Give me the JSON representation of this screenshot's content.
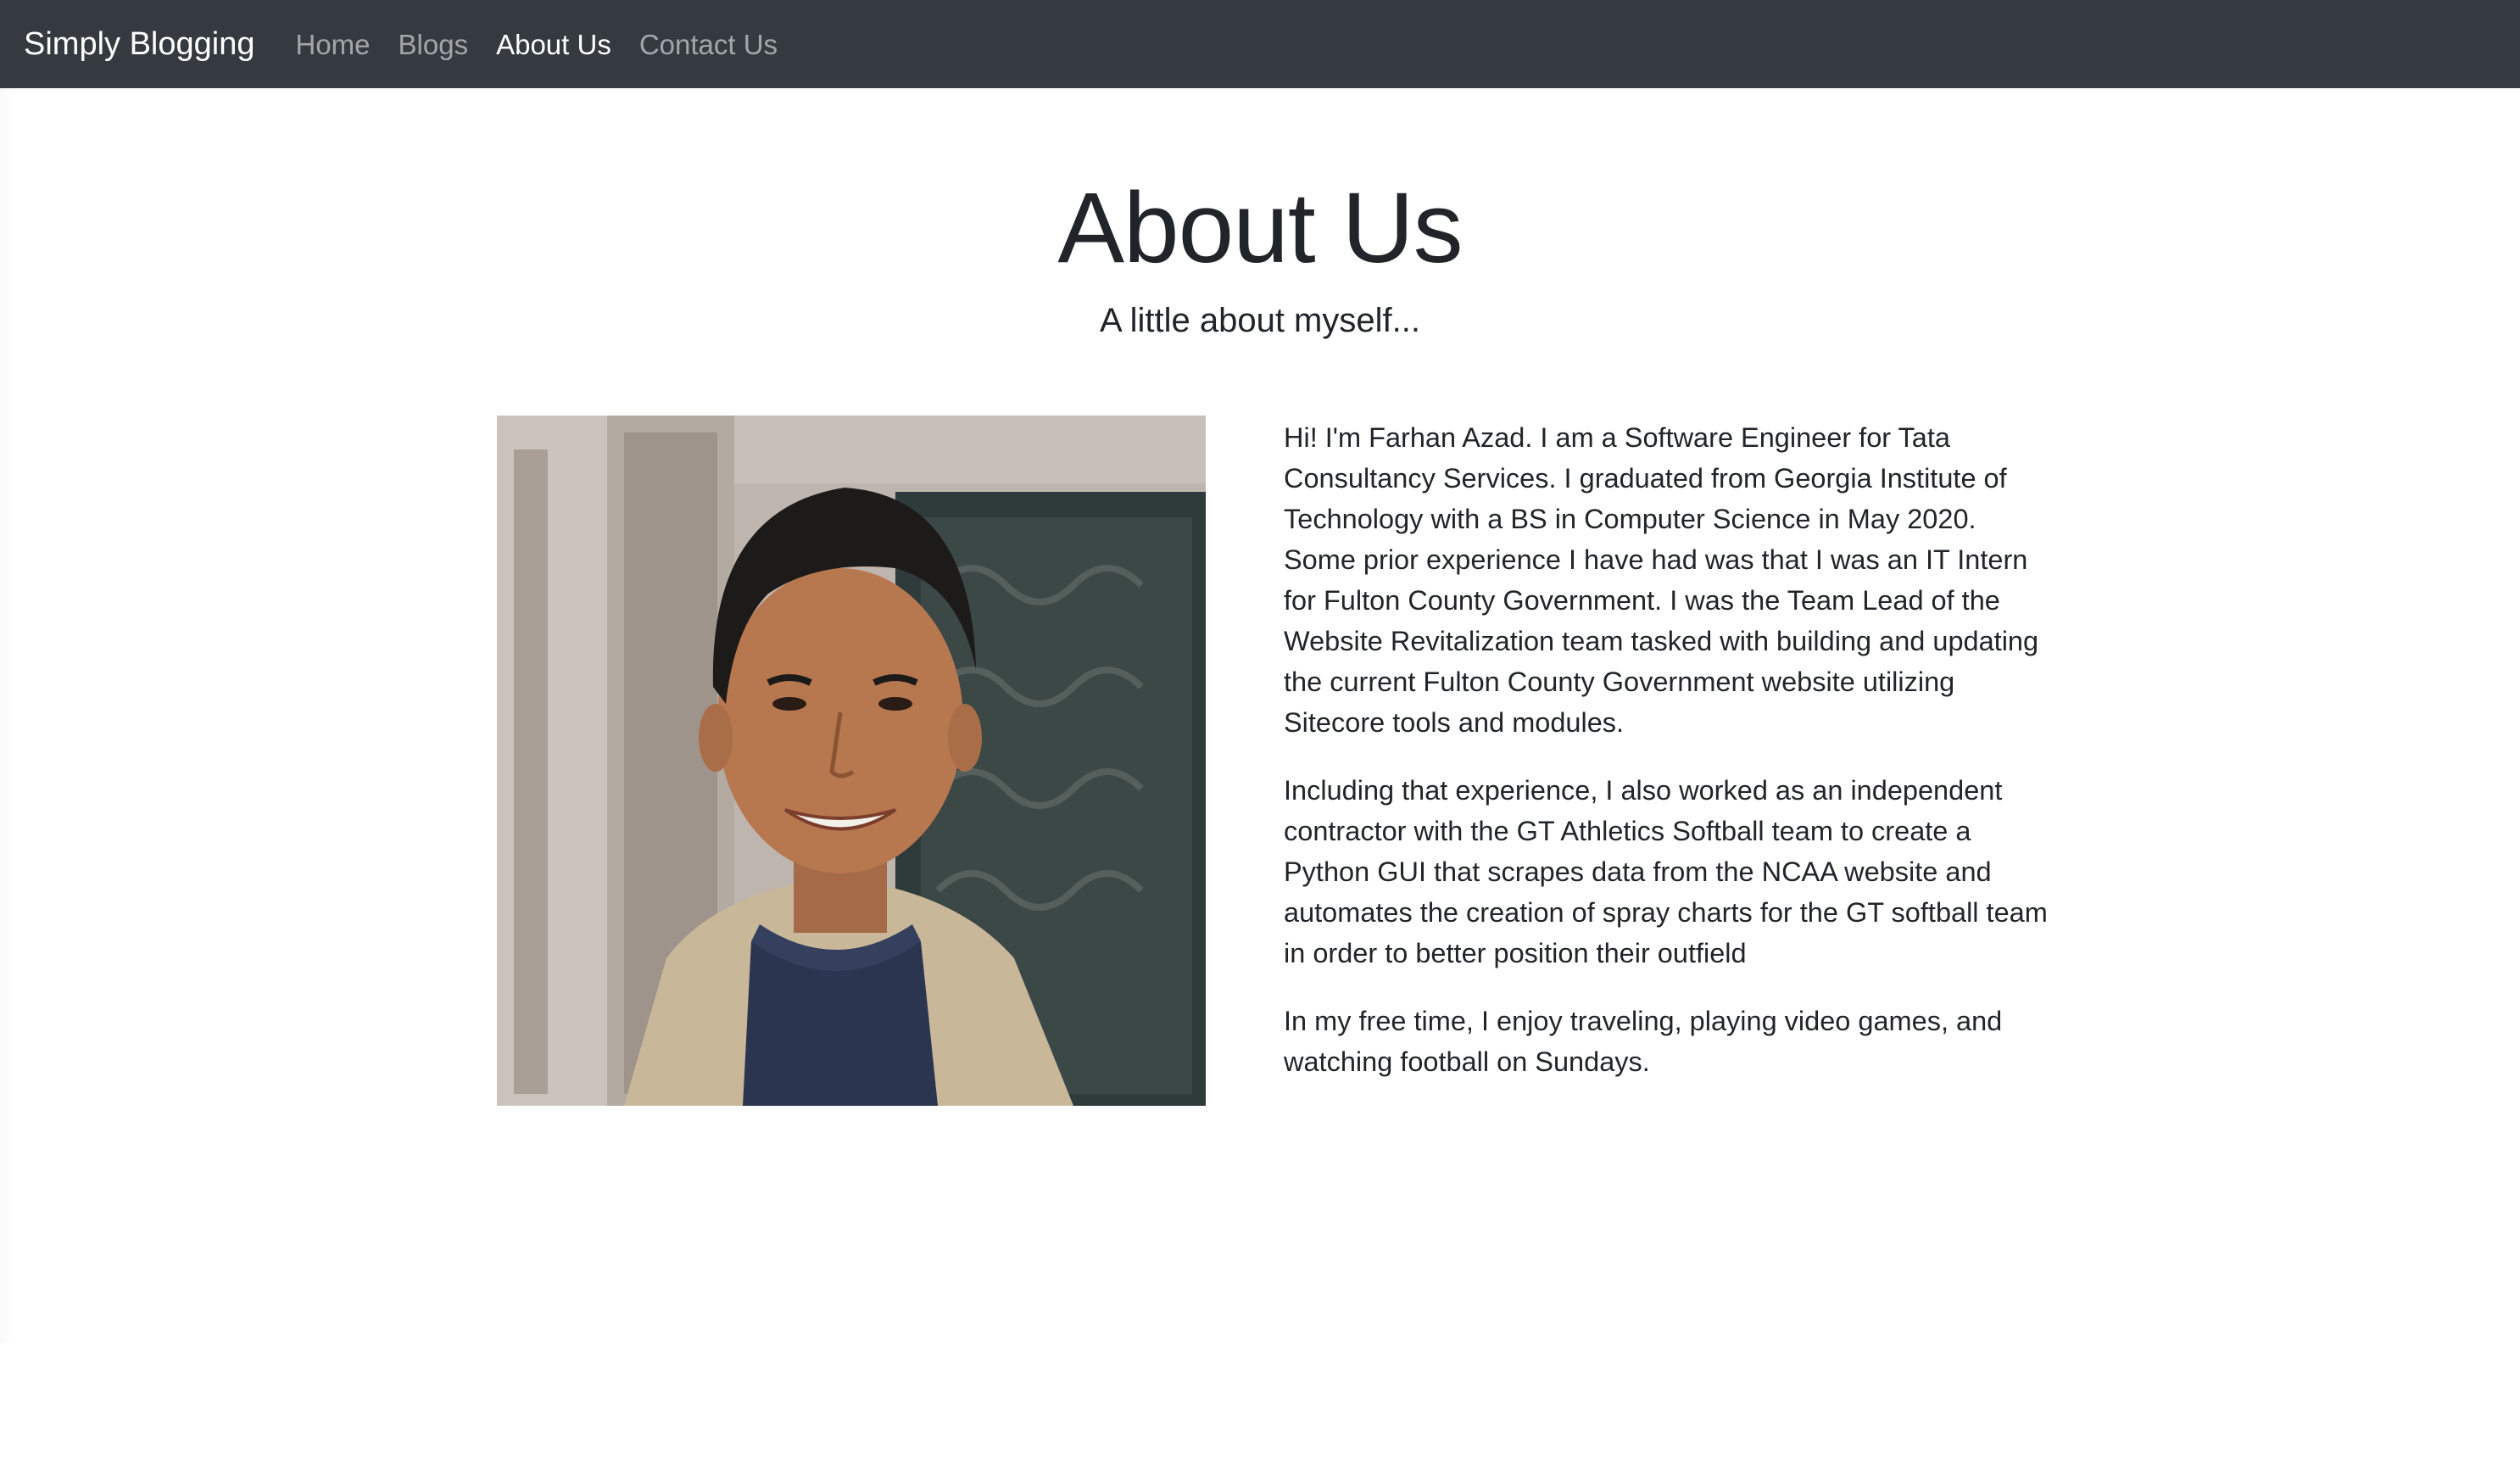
{
  "navbar": {
    "brand": "Simply Blogging",
    "links": [
      {
        "label": "Home",
        "active": false
      },
      {
        "label": "Blogs",
        "active": false
      },
      {
        "label": "About Us",
        "active": true
      },
      {
        "label": "Contact Us",
        "active": false
      }
    ]
  },
  "hero": {
    "title": "About Us",
    "subtitle": "A little about myself..."
  },
  "profile": {
    "image_icon": "portrait-photo"
  },
  "bio": {
    "paragraphs": [
      "Hi! I'm Farhan Azad. I am a Software Engineer for Tata Consultancy Services. I graduated from Georgia Institute of Technology with a BS in Computer Science in May 2020. Some prior experience I have had was that I was an IT Intern for Fulton County Government. I was the Team Lead of the Website Revitalization team tasked with building and updating the current Fulton County Government website utilizing Sitecore tools and modules.",
      "Including that experience, I also worked as an independent contractor with the GT Athletics Softball team to create a Python GUI that scrapes data from the NCAA website and automates the creation of spray charts for the GT softball team in order to better position their outfield",
      "In my free time, I enjoy traveling, playing video games, and watching football on Sundays."
    ]
  },
  "colors": {
    "navbar_bg": "#343a40",
    "nav_active": "#ffffff",
    "nav_inactive": "rgba(255,255,255,0.55)",
    "text": "#212529"
  }
}
